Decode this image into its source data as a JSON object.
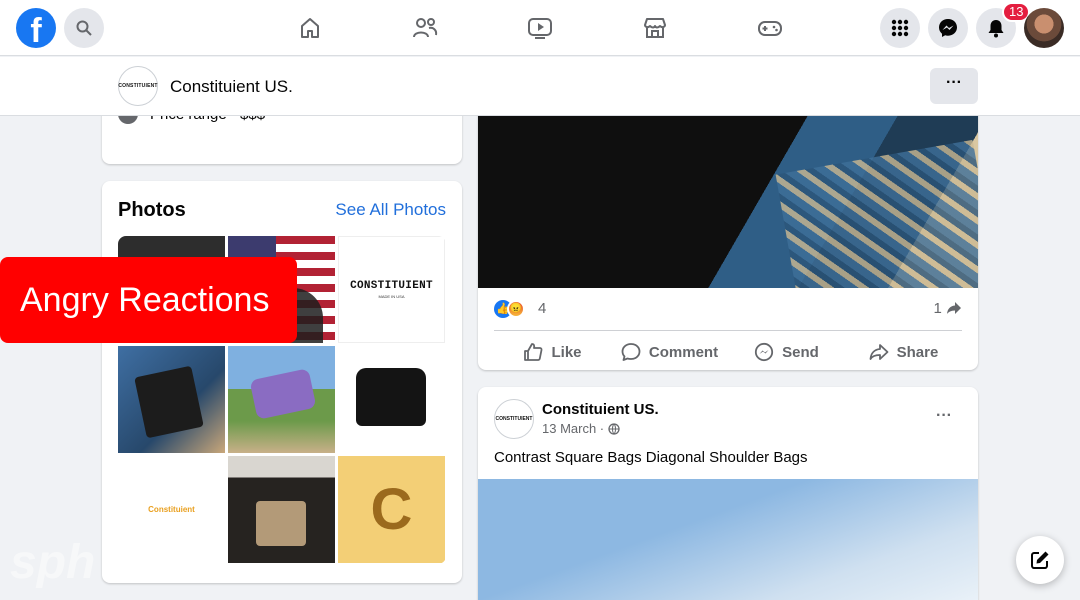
{
  "topbar": {
    "logo_letter": "f",
    "notification_count": "13"
  },
  "page_header": {
    "logo_text": "CONSTITUIENT",
    "page_name": "Constituient US.",
    "more_label": "···"
  },
  "about": {
    "price_range": "Price range · $$$"
  },
  "photos": {
    "title": "Photos",
    "see_all": "See All Photos",
    "tile3_main": "CONSTITUIENT",
    "tile3_sub": "MADE IN USA",
    "tile7_text": "Constituient",
    "tile9_letter": "C"
  },
  "overlay": {
    "label": "Angry Reactions"
  },
  "post1": {
    "reaction_count": "4",
    "share_count": "1",
    "actions": {
      "like": "Like",
      "comment": "Comment",
      "send": "Send",
      "share": "Share"
    }
  },
  "post2": {
    "logo_text": "CONSTITUIENT",
    "author": "Constituient US.",
    "date": "13 March ·",
    "text": "Contrast Square Bags Diagonal Shoulder Bags",
    "more_label": "···"
  },
  "watermark": "sph",
  "colors": {
    "facebook_blue": "#1877f2",
    "link_blue": "#216fdb",
    "overlay_red": "#ff0000",
    "badge_red": "#e41e3f"
  }
}
